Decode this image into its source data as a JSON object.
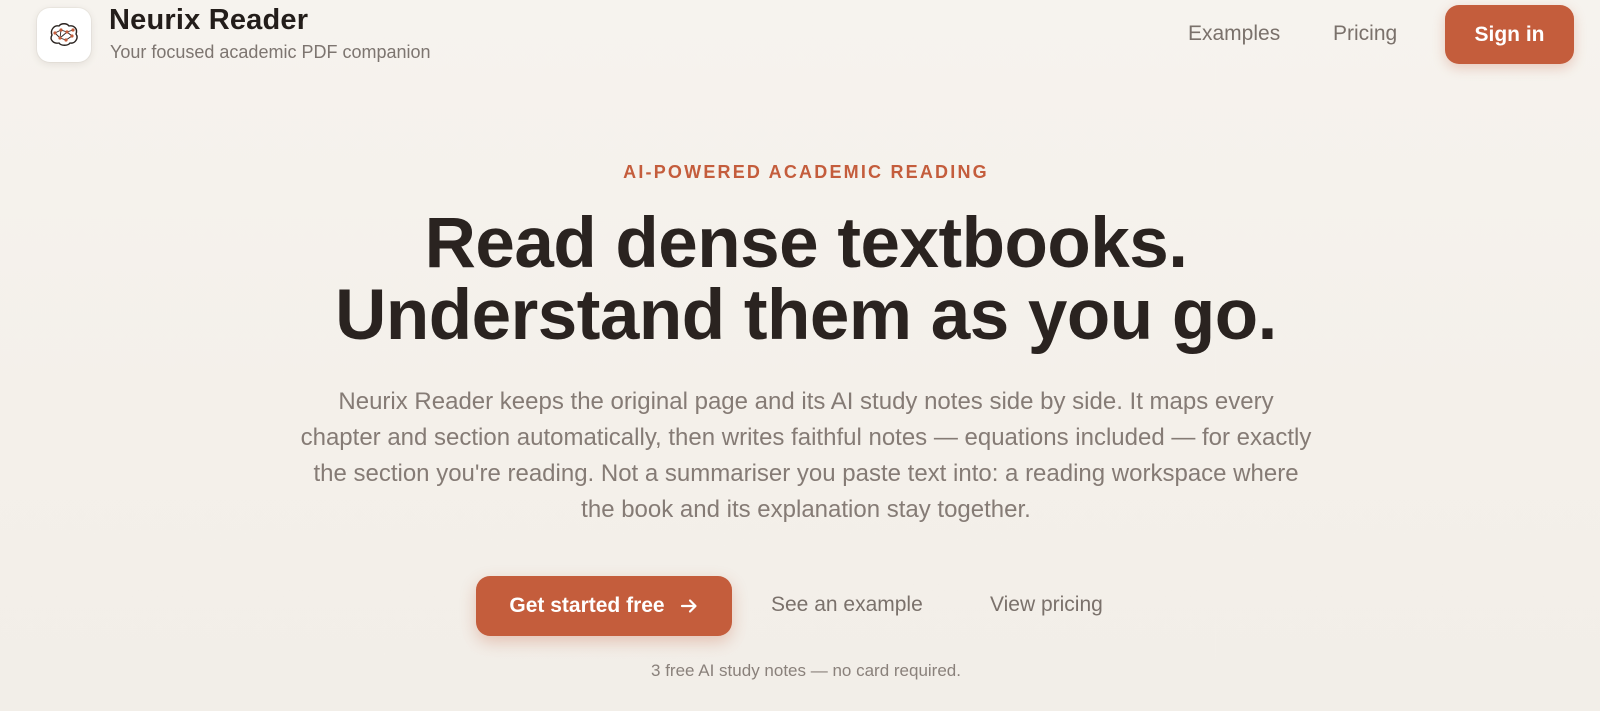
{
  "header": {
    "logo_icon": "brain-network-icon",
    "brand_name": "Neurix Reader",
    "tagline": "Your focused academic PDF companion",
    "nav": {
      "examples_label": "Examples",
      "pricing_label": "Pricing",
      "signin_label": "Sign in"
    }
  },
  "hero": {
    "eyebrow": "AI-POWERED ACADEMIC READING",
    "headline_line1": "Read dense textbooks.",
    "headline_line2": "Understand them as you go.",
    "description": "Neurix Reader keeps the original page and its AI study notes side by side. It maps every chapter and section automatically, then writes faithful notes — equations included — for exactly the section you're reading. Not a summariser you paste text into: a reading workspace where the book and its explanation stay together.",
    "cta_primary_label": "Get started free",
    "cta_primary_icon": "arrow-right-icon",
    "cta_example_label": "See an example",
    "cta_pricing_label": "View pricing",
    "footnote": "3 free AI study notes — no card required."
  },
  "colors": {
    "accent": "#c45d3c",
    "heading": "#2a2320",
    "muted": "#857b75",
    "background": "#f5f2ec"
  }
}
